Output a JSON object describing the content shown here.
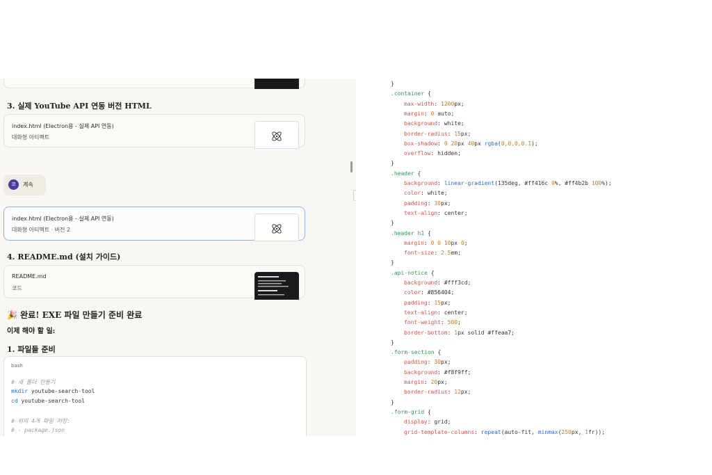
{
  "chat": {
    "heading3": "3. 실제 YouTube API 연동 버전 HTML",
    "card1": {
      "title": "index.html (Electron용 - 실제 API 연동)",
      "subtitle": "대화형 아티팩트"
    },
    "continue_button": {
      "avatar": "코",
      "label": "계속"
    },
    "card2": {
      "title": "index.html (Electron용 - 실제 API 연동)",
      "subtitle": "대화형 아티팩트 · 버전 2"
    },
    "heading4": "4. README.md (설치 가이드)",
    "card3": {
      "title": "README.md",
      "subtitle": "코드"
    },
    "done_heading": "🎉 완료! EXE 파일 만들기 준비 완료",
    "todo_heading": "이제 해야 할 일:",
    "step1_heading": "1. 파일들 준비",
    "codeblock": {
      "lang": "bash",
      "lines": [
        {
          "type": "comment",
          "text": "# 새 폴더 만들기"
        },
        {
          "type": "cmd",
          "kw": "mkdir",
          "arg": " youtube-search-tool"
        },
        {
          "type": "cmd",
          "kw": "cd",
          "arg": " youtube-search-tool"
        },
        {
          "type": "blank",
          "text": ""
        },
        {
          "type": "comment",
          "text": "# 위의 4개 파일 저장:"
        },
        {
          "type": "comment",
          "text": "# - package.json"
        }
      ]
    }
  },
  "css_code": [
    [
      {
        "c": "txt",
        "t": "}"
      }
    ],
    [
      {
        "c": "sel",
        "t": ".container"
      },
      {
        "c": "txt",
        "t": " {"
      }
    ],
    [
      {
        "c": "prop",
        "t": "max-width"
      },
      {
        "c": "txt",
        "t": ": "
      },
      {
        "c": "num",
        "t": "1200"
      },
      {
        "c": "txt",
        "t": "px;"
      }
    ],
    [
      {
        "c": "prop",
        "t": "margin"
      },
      {
        "c": "txt",
        "t": ": "
      },
      {
        "c": "num",
        "t": "0"
      },
      {
        "c": "txt",
        "t": " auto;"
      }
    ],
    [
      {
        "c": "prop",
        "t": "background"
      },
      {
        "c": "txt",
        "t": ": white;"
      }
    ],
    [
      {
        "c": "prop",
        "t": "border-radius"
      },
      {
        "c": "txt",
        "t": ": "
      },
      {
        "c": "num",
        "t": "15"
      },
      {
        "c": "txt",
        "t": "px;"
      }
    ],
    [
      {
        "c": "prop",
        "t": "box-shadow"
      },
      {
        "c": "txt",
        "t": ": "
      },
      {
        "c": "num",
        "t": "0 20"
      },
      {
        "c": "txt",
        "t": "px "
      },
      {
        "c": "num",
        "t": "40"
      },
      {
        "c": "txt",
        "t": "px "
      },
      {
        "c": "fn",
        "t": "rgba"
      },
      {
        "c": "txt",
        "t": "("
      },
      {
        "c": "num",
        "t": "0,0,0,0.1"
      },
      {
        "c": "txt",
        "t": ");"
      }
    ],
    [
      {
        "c": "prop",
        "t": "overflow"
      },
      {
        "c": "txt",
        "t": ": hidden;"
      }
    ],
    [
      {
        "c": "txt",
        "t": "}"
      }
    ],
    [
      {
        "c": "sel",
        "t": ".header"
      },
      {
        "c": "txt",
        "t": " {"
      }
    ],
    [
      {
        "c": "prop",
        "t": "background"
      },
      {
        "c": "txt",
        "t": ": "
      },
      {
        "c": "fn",
        "t": "linear-gradient"
      },
      {
        "c": "txt",
        "t": "(135deg, #ff416c "
      },
      {
        "c": "num",
        "t": "0"
      },
      {
        "c": "txt",
        "t": "%, #ff4b2b "
      },
      {
        "c": "num",
        "t": "100"
      },
      {
        "c": "txt",
        "t": "%);"
      }
    ],
    [
      {
        "c": "prop",
        "t": "color"
      },
      {
        "c": "txt",
        "t": ": white;"
      }
    ],
    [
      {
        "c": "prop",
        "t": "padding"
      },
      {
        "c": "txt",
        "t": ": "
      },
      {
        "c": "num",
        "t": "30"
      },
      {
        "c": "txt",
        "t": "px;"
      }
    ],
    [
      {
        "c": "prop",
        "t": "text-align"
      },
      {
        "c": "txt",
        "t": ": center;"
      }
    ],
    [
      {
        "c": "txt",
        "t": "}"
      }
    ],
    [
      {
        "c": "sel",
        "t": ".header h1"
      },
      {
        "c": "txt",
        "t": " {"
      }
    ],
    [
      {
        "c": "prop",
        "t": "margin"
      },
      {
        "c": "txt",
        "t": ": "
      },
      {
        "c": "num",
        "t": "0 0 10"
      },
      {
        "c": "txt",
        "t": "px "
      },
      {
        "c": "num",
        "t": "0"
      },
      {
        "c": "txt",
        "t": ";"
      }
    ],
    [
      {
        "c": "prop",
        "t": "font-size"
      },
      {
        "c": "txt",
        "t": ": "
      },
      {
        "c": "num",
        "t": "2.5"
      },
      {
        "c": "txt",
        "t": "em;"
      }
    ],
    [
      {
        "c": "txt",
        "t": "}"
      }
    ],
    [
      {
        "c": "sel",
        "t": ".api-notice"
      },
      {
        "c": "txt",
        "t": " {"
      }
    ],
    [
      {
        "c": "prop",
        "t": "background"
      },
      {
        "c": "txt",
        "t": ": #fff3cd;"
      }
    ],
    [
      {
        "c": "prop",
        "t": "color"
      },
      {
        "c": "txt",
        "t": ": #856404;"
      }
    ],
    [
      {
        "c": "prop",
        "t": "padding"
      },
      {
        "c": "txt",
        "t": ": "
      },
      {
        "c": "num",
        "t": "15"
      },
      {
        "c": "txt",
        "t": "px;"
      }
    ],
    [
      {
        "c": "prop",
        "t": "text-align"
      },
      {
        "c": "txt",
        "t": ": center;"
      }
    ],
    [
      {
        "c": "prop",
        "t": "font-weight"
      },
      {
        "c": "txt",
        "t": ": "
      },
      {
        "c": "num",
        "t": "500"
      },
      {
        "c": "txt",
        "t": ";"
      }
    ],
    [
      {
        "c": "prop",
        "t": "border-bottom"
      },
      {
        "c": "txt",
        "t": ": "
      },
      {
        "c": "num",
        "t": "1"
      },
      {
        "c": "txt",
        "t": "px solid #ffeaa7;"
      }
    ],
    [
      {
        "c": "txt",
        "t": "}"
      }
    ],
    [
      {
        "c": "sel",
        "t": ".form-section"
      },
      {
        "c": "txt",
        "t": " {"
      }
    ],
    [
      {
        "c": "prop",
        "t": "padding"
      },
      {
        "c": "txt",
        "t": ": "
      },
      {
        "c": "num",
        "t": "30"
      },
      {
        "c": "txt",
        "t": "px;"
      }
    ],
    [
      {
        "c": "prop",
        "t": "background"
      },
      {
        "c": "txt",
        "t": ": #f8f9ff;"
      }
    ],
    [
      {
        "c": "prop",
        "t": "margin"
      },
      {
        "c": "txt",
        "t": ": "
      },
      {
        "c": "num",
        "t": "20"
      },
      {
        "c": "txt",
        "t": "px;"
      }
    ],
    [
      {
        "c": "prop",
        "t": "border-radius"
      },
      {
        "c": "txt",
        "t": ": "
      },
      {
        "c": "num",
        "t": "12"
      },
      {
        "c": "txt",
        "t": "px;"
      }
    ],
    [
      {
        "c": "txt",
        "t": "}"
      }
    ],
    [
      {
        "c": "sel",
        "t": ".form-grid"
      },
      {
        "c": "txt",
        "t": " {"
      }
    ],
    [
      {
        "c": "prop",
        "t": "display"
      },
      {
        "c": "txt",
        "t": ": grid;"
      }
    ],
    [
      {
        "c": "prop",
        "t": "grid-template-columns"
      },
      {
        "c": "txt",
        "t": ": "
      },
      {
        "c": "fn",
        "t": "repeat"
      },
      {
        "c": "txt",
        "t": "(auto-fit, "
      },
      {
        "c": "fn",
        "t": "minmax"
      },
      {
        "c": "txt",
        "t": "("
      },
      {
        "c": "num",
        "t": "250"
      },
      {
        "c": "txt",
        "t": "px, "
      },
      {
        "c": "num",
        "t": "1"
      },
      {
        "c": "txt",
        "t": "fr));"
      }
    ]
  ]
}
